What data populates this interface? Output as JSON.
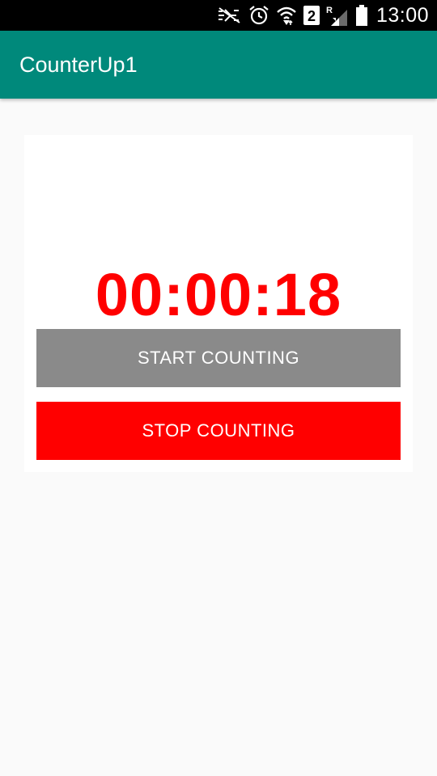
{
  "status_bar": {
    "time": "13:00",
    "sim_slot": "2",
    "roaming": "R",
    "icons": [
      "mute-icon",
      "alarm-icon",
      "wifi-icon",
      "sim-2-icon",
      "signal-icon",
      "battery-icon"
    ]
  },
  "app_bar": {
    "title": "CounterUp1",
    "color": "#00897b"
  },
  "counter": {
    "value": "00:00:18",
    "color": "#ff0000"
  },
  "buttons": {
    "start_label": "START COUNTING",
    "start_color": "#8a8a8a",
    "stop_label": "STOP COUNTING",
    "stop_color": "#ff0000"
  }
}
